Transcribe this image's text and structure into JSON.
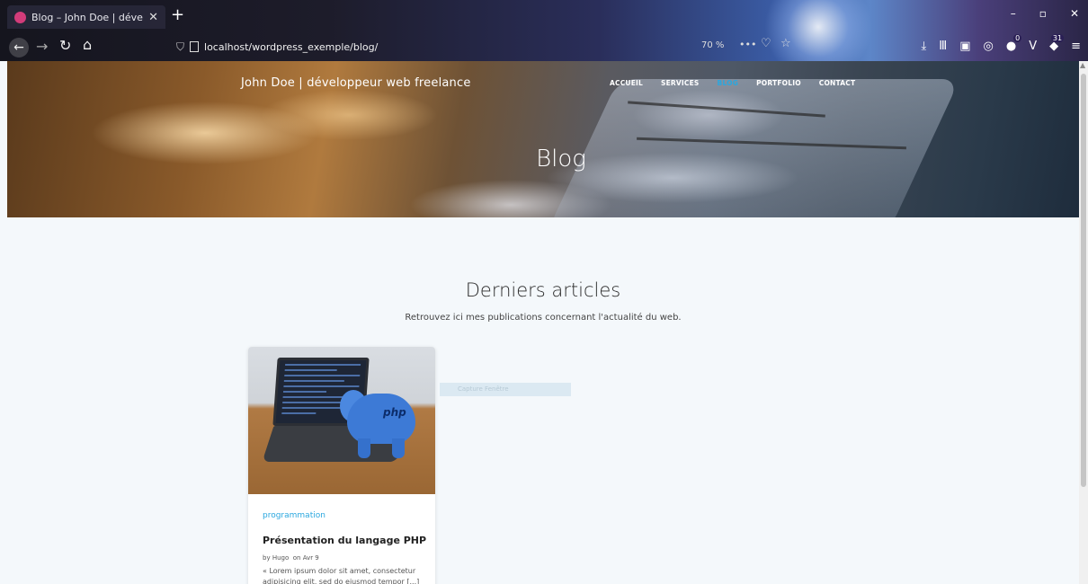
{
  "browser": {
    "tab_title": "Blog – John Doe | développeur",
    "tab_close": "✕",
    "new_tab": "+",
    "url": "localhost/wordpress_exemple/blog/",
    "zoom": "70 %",
    "more": "•••",
    "extension_badge_1": "0",
    "extension_badge_2": "31",
    "window_controls": {
      "minimize": "–",
      "restore": "▫",
      "close": "✕"
    }
  },
  "site": {
    "title": "John Doe | développeur web freelance",
    "nav": [
      {
        "label": "ACCUEIL",
        "active": false
      },
      {
        "label": "SERVICES",
        "active": false
      },
      {
        "label": "BLOG",
        "active": true
      },
      {
        "label": "PORTFOLIO",
        "active": false
      },
      {
        "label": "CONTACT",
        "active": false
      }
    ],
    "hero_title": "Blog"
  },
  "section": {
    "title": "Derniers articles",
    "subtitle": "Retrouvez ici mes publications concernant l'actualité du web."
  },
  "posts": [
    {
      "category": "programmation",
      "title": "Présentation du langage PHP",
      "author_prefix": "by",
      "author": "Hugo",
      "date_prefix": "on",
      "date": "Avr 9",
      "excerpt": "« Lorem ipsum dolor sit amet, consectetur adipisicing elit, sed do eiusmod tempor [...]"
    }
  ],
  "overlay": {
    "capture_label": "Capture Fenêtre"
  },
  "colors": {
    "accent": "#2aa7df",
    "page_bg": "#f4f8fb"
  }
}
